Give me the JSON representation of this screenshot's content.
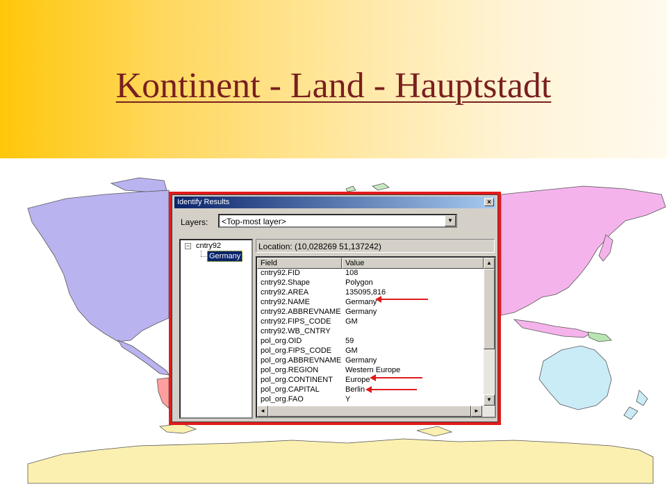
{
  "slide": {
    "title": "Kontinent - Land - Hauptstadt"
  },
  "dialog": {
    "title": "Identify Results",
    "close_glyph": "×",
    "layers_label": "Layers:",
    "layers_value": "<Top-most layer>",
    "tree_root": "cntry92",
    "tree_toggle": "−",
    "tree_selected": "Germany",
    "location": "Location: (10,028269 51,137242)",
    "columns": [
      "Field",
      "Value"
    ],
    "rows": [
      {
        "field": "cntry92.FID",
        "value": "108"
      },
      {
        "field": "cntry92.Shape",
        "value": "Polygon"
      },
      {
        "field": "cntry92.AREA",
        "value": "135095,816"
      },
      {
        "field": "cntry92.NAME",
        "value": "Germany"
      },
      {
        "field": "cntry92.ABBREVNAME",
        "value": "Germany"
      },
      {
        "field": "cntry92.FIPS_CODE",
        "value": "GM"
      },
      {
        "field": "cntry92.WB_CNTRY",
        "value": ""
      },
      {
        "field": "pol_org.OID",
        "value": "59"
      },
      {
        "field": "pol_org.FIPS_CODE",
        "value": "GM"
      },
      {
        "field": "pol_org.ABBREVNAME",
        "value": "Germany"
      },
      {
        "field": "pol_org.REGION",
        "value": "Western Europe"
      },
      {
        "field": "pol_org.CONTINENT",
        "value": "Europe"
      },
      {
        "field": "pol_org.CAPITAL",
        "value": "Berlin"
      },
      {
        "field": "pol_org.FAO",
        "value": "Y"
      },
      {
        "field": "",
        "value": ""
      }
    ],
    "scroll_up": "▲",
    "scroll_down": "▼",
    "scroll_left": "◄",
    "scroll_right": "►",
    "dropdown_glyph": "▼"
  },
  "colors": {
    "highlight_frame": "#e11b1b",
    "north_america": "#b9b3f0",
    "south_america": "#ff9e9e",
    "asia": "#f5b3ec",
    "australia": "#c9ecf7",
    "antarctica": "#fbf0b0",
    "greenland": "#b9b3f0"
  }
}
